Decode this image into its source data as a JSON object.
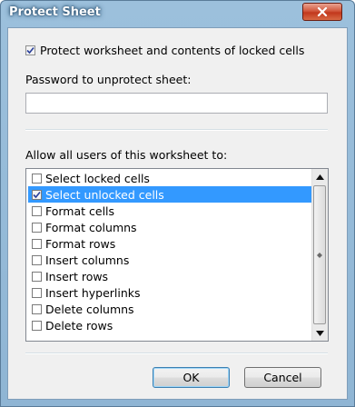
{
  "window": {
    "title": "Protect Sheet"
  },
  "protect": {
    "label": "Protect worksheet and contents of locked cells",
    "checked": true
  },
  "password": {
    "label": "Password to unprotect sheet:",
    "value": ""
  },
  "allow": {
    "label": "Allow all users of this worksheet to:",
    "items": [
      {
        "label": "Select locked cells",
        "checked": false,
        "selected": false
      },
      {
        "label": "Select unlocked cells",
        "checked": true,
        "selected": true
      },
      {
        "label": "Format cells",
        "checked": false,
        "selected": false
      },
      {
        "label": "Format columns",
        "checked": false,
        "selected": false
      },
      {
        "label": "Format rows",
        "checked": false,
        "selected": false
      },
      {
        "label": "Insert columns",
        "checked": false,
        "selected": false
      },
      {
        "label": "Insert rows",
        "checked": false,
        "selected": false
      },
      {
        "label": "Insert hyperlinks",
        "checked": false,
        "selected": false
      },
      {
        "label": "Delete columns",
        "checked": false,
        "selected": false
      },
      {
        "label": "Delete rows",
        "checked": false,
        "selected": false
      }
    ]
  },
  "buttons": {
    "ok": "OK",
    "cancel": "Cancel"
  }
}
